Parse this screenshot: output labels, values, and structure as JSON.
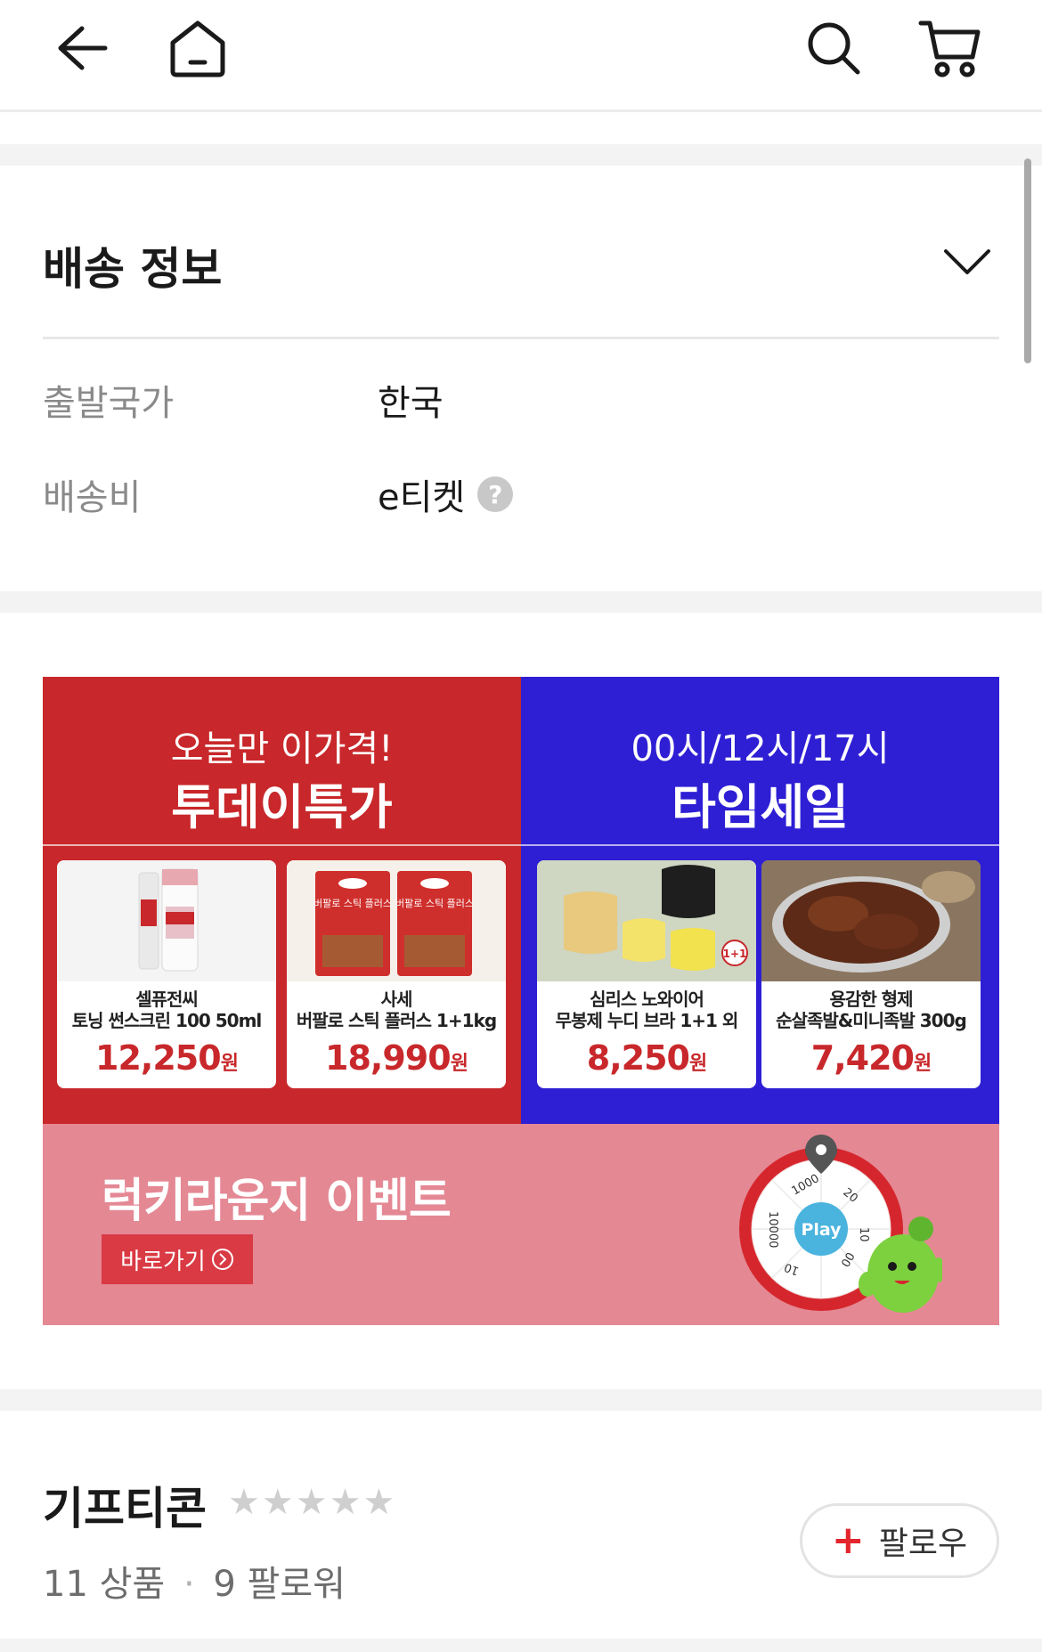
{
  "header": {
    "icons": [
      "back-arrow-icon",
      "home-icon",
      "search-icon",
      "cart-icon"
    ]
  },
  "shipping": {
    "title": "배송 정보",
    "rows": [
      {
        "label": "출발국가",
        "value": "한국"
      },
      {
        "label": "배송비",
        "value": "e티켓"
      }
    ],
    "help_icon": "?"
  },
  "banner": {
    "left": {
      "sub": "오늘만 이가격!",
      "title": "투데이특가",
      "color": "#c8282b",
      "items": [
        {
          "brand": "셀퓨전씨",
          "name": "토닝 썬스크린 100 50ml",
          "price": "12,250",
          "won": "원"
        },
        {
          "brand": "사세",
          "name": "버팔로 스틱 플러스 1+1kg",
          "price": "18,990",
          "won": "원"
        }
      ]
    },
    "right": {
      "sub": "00시/12시/17시",
      "title": "타임세일",
      "color": "#2e1fd4",
      "items": [
        {
          "brand": "심리스 노와이어",
          "name": "무봉제 누디 브라 1+1 외",
          "price": "8,250",
          "won": "원"
        },
        {
          "brand": "용감한 형제",
          "name": "순살족발&미니족발 300g",
          "price": "7,420",
          "won": "원"
        }
      ]
    },
    "lucky": {
      "title": "럭키라운지 이벤트",
      "go_label": "바로가기",
      "wheel_center": "Play",
      "wheel_labels": [
        "1000",
        "20",
        "10",
        "00",
        "10",
        "10000"
      ],
      "badge": "1+1",
      "pack_text": "버팔로 스틱 플러스",
      "color": "#e48894"
    }
  },
  "seller": {
    "name": "기프티콘",
    "rating_stars": "★★★★★",
    "products": "11 상품",
    "dot": "·",
    "followers": "9 팔로워",
    "follow_label": "팔로우"
  }
}
